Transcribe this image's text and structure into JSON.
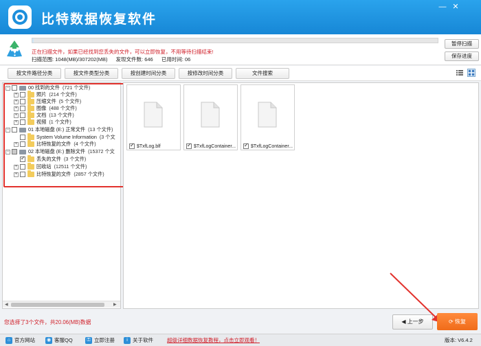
{
  "app": {
    "title": "比特数据恢复软件",
    "minimize_label": "—",
    "close_label": "✕"
  },
  "status": {
    "message": "正在扫描文件，如果已经找到您丢失的文件，可以立即恢复，不用等待扫描结束!",
    "scan_range": "扫描范围: 1048(MB)/307202(MB)",
    "found_files": "发现文件数: 646",
    "elapsed": "已用时间: 06",
    "progress_fraction": 0.003
  },
  "buttons": {
    "pause": "暂停扫描",
    "save_progress": "保存进度",
    "prev": "上一步",
    "recover": "恢复"
  },
  "tabs": [
    {
      "label": "按文件路径分类"
    },
    {
      "label": "按文件类型分类"
    },
    {
      "label": "按创建时间分类"
    },
    {
      "label": "按修改时间分类"
    },
    {
      "label": "文件搜索"
    }
  ],
  "tree": [
    {
      "label": "00 找到的文件",
      "count": "(721 个文件)"
    },
    {
      "label": "照片",
      "count": "(214 个文件)"
    },
    {
      "label": "压缩文件",
      "count": "(5 个文件)"
    },
    {
      "label": "图像",
      "count": "(488 个文件)"
    },
    {
      "label": "文档",
      "count": "(13 个文件)"
    },
    {
      "label": "视频",
      "count": "(1 个文件)"
    },
    {
      "label": "01 本地磁盘 (E:) 正常文件",
      "count": "(13 个文件)"
    },
    {
      "label": "System Volume Information",
      "count": "(3 个文"
    },
    {
      "label": "比特恢复的文件",
      "count": "(4 个文件)"
    },
    {
      "label": "02 本地磁盘 (E:) 删除文件",
      "count": "(15372 个文"
    },
    {
      "label": "丢失的文件",
      "count": "(3 个文件)"
    },
    {
      "label": "回收站",
      "count": "(12511 个文件)"
    },
    {
      "label": "比特恢复的文件",
      "count": "(2857 个文件)"
    }
  ],
  "files": [
    {
      "name": "$TxfLog.blf"
    },
    {
      "name": "$TxfLogContainer..."
    },
    {
      "name": "$TxfLogContainer..."
    }
  ],
  "selection_info": "您选择了3个文件，共20.06(MB)数据",
  "footer": {
    "website": "官方网站",
    "qq": "客服QQ",
    "register": "立即注册",
    "about": "关于软件",
    "tutorial_link": "超级详细数据恢复教程，点击立即观看！",
    "version": "版本: V6.4.2"
  },
  "colors": {
    "title_bar": "#1d8fdc",
    "status_red": "#d0202a",
    "recover_orange": "#f06c1a",
    "highlight_red": "#e2312c"
  }
}
